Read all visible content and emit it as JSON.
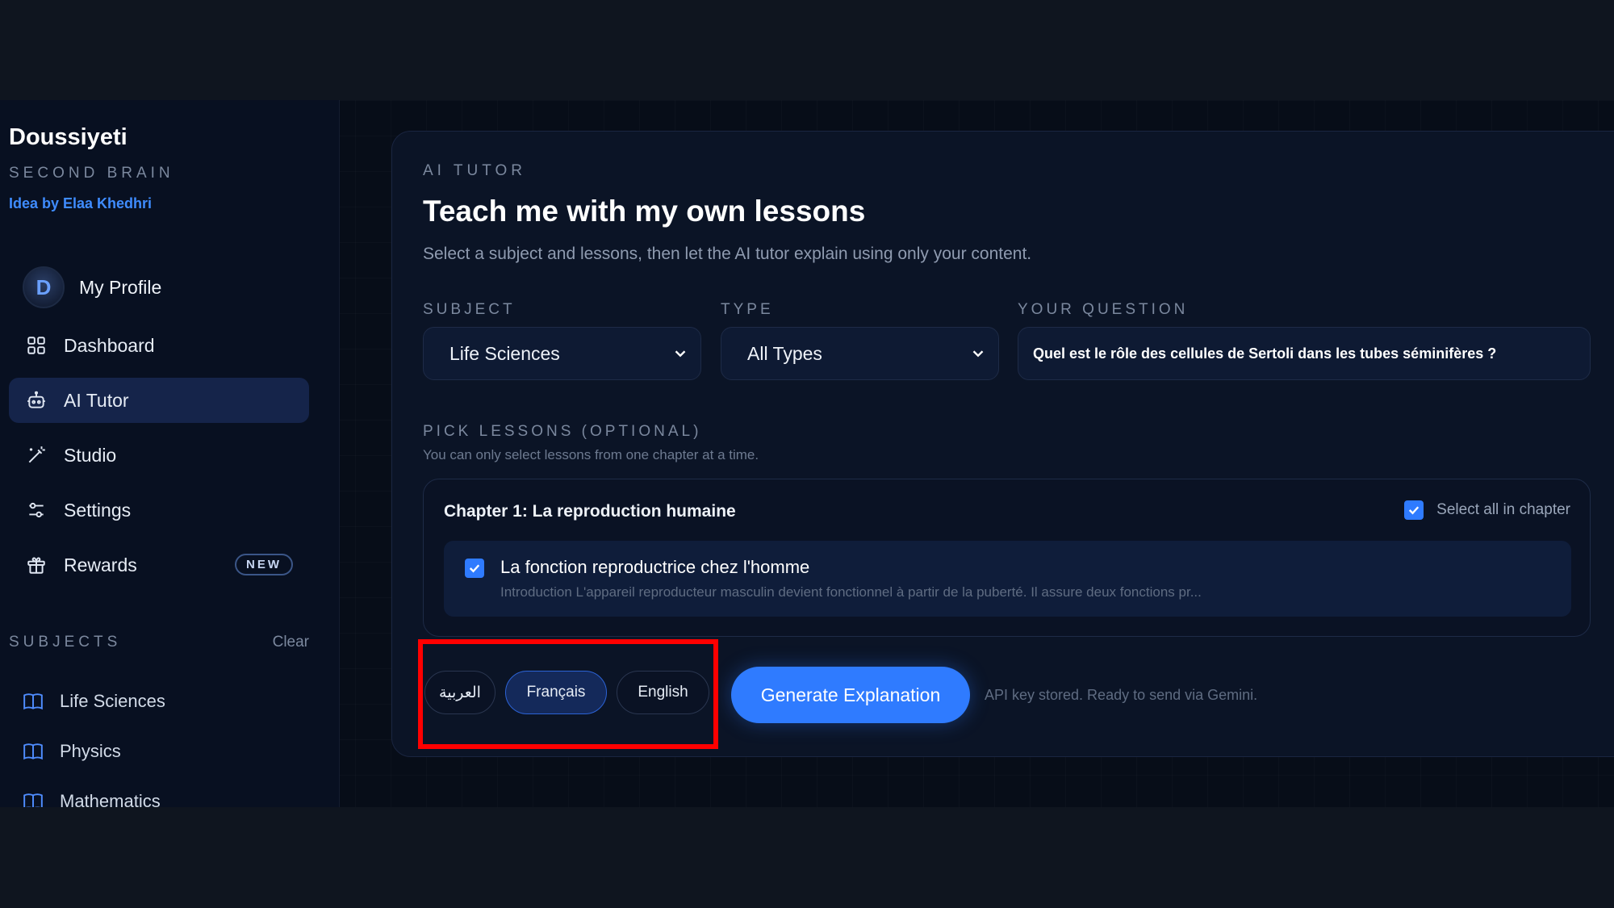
{
  "sidebar": {
    "brand_title": "Doussiyeti",
    "brand_subtitle": "SECOND BRAIN",
    "brand_credit": "Idea by Elaa Khedhri",
    "profile": {
      "avatar_letter": "D",
      "label": "My Profile"
    },
    "nav": [
      {
        "label": "Dashboard",
        "icon": "dashboard-icon"
      },
      {
        "label": "AI Tutor",
        "icon": "robot-icon",
        "active": true
      },
      {
        "label": "Studio",
        "icon": "magic-wand-icon"
      },
      {
        "label": "Settings",
        "icon": "sliders-icon"
      },
      {
        "label": "Rewards",
        "icon": "gift-icon",
        "badge": "NEW"
      }
    ],
    "subjects_title": "SUBJECTS",
    "subjects_clear": "Clear",
    "subjects": [
      "Life Sciences",
      "Physics",
      "Mathematics"
    ]
  },
  "main": {
    "eyebrow": "AI TUTOR",
    "title": "Teach me with my own lessons",
    "subtitle": "Select a subject and lessons, then let the AI tutor explain using only your content.",
    "subject_label": "SUBJECT",
    "subject_value": "Life Sciences",
    "type_label": "TYPE",
    "type_value": "All Types",
    "question_label": "YOUR QUESTION",
    "question_value": "Quel est le rôle des cellules de Sertoli dans les tubes séminifères ?",
    "pick_label": "PICK LESSONS (OPTIONAL)",
    "pick_hint": "You can only select lessons from one chapter at a time.",
    "chapter": {
      "title": "Chapter 1: La reproduction humaine",
      "select_all_label": "Select all in chapter",
      "select_all_checked": true,
      "lesson": {
        "title": "La fonction reproductrice chez l'homme",
        "description": "Introduction L'appareil reproducteur masculin devient fonctionnel à partir de la puberté. Il assure deux fonctions pr...",
        "checked": true
      }
    },
    "languages": [
      {
        "label": "العربية",
        "active": false
      },
      {
        "label": "Français",
        "active": true
      },
      {
        "label": "English",
        "active": false
      }
    ],
    "generate_label": "Generate Explanation",
    "status_text": "API key stored. Ready to send via Gemini."
  },
  "colors": {
    "accent": "#2f7bff",
    "credit": "#3f8cff",
    "highlight": "#ff0000",
    "background": "#070d18"
  }
}
